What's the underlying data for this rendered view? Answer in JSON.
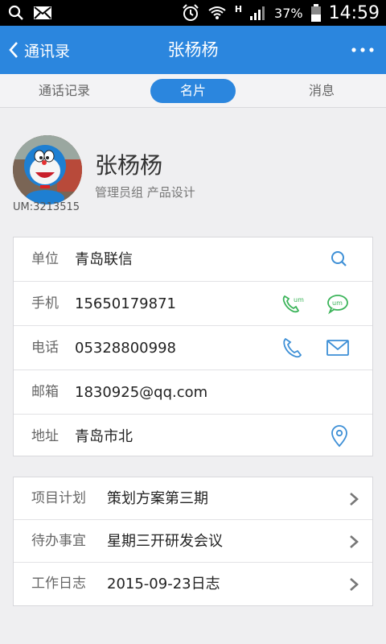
{
  "status_bar": {
    "battery": "37%",
    "network": "H",
    "time": "14:59"
  },
  "header": {
    "back_label": "通讯录",
    "title": "张杨杨"
  },
  "tabs": [
    {
      "label": "通话记录"
    },
    {
      "label": "名片",
      "selected": true
    },
    {
      "label": "消息"
    }
  ],
  "profile": {
    "name": "张杨杨",
    "department": "管理员组 产品设计",
    "um": "UM:3213515"
  },
  "info": [
    {
      "label": "单位",
      "value": "青岛联信",
      "actions": [
        "search-icon"
      ]
    },
    {
      "label": "手机",
      "value": "15650179871",
      "actions": [
        "um-call-icon",
        "um-chat-icon"
      ]
    },
    {
      "label": "电话",
      "value": "05328800998",
      "actions": [
        "phone-icon",
        "mail-icon"
      ]
    },
    {
      "label": "邮箱",
      "value": "1830925@qq.com",
      "actions": []
    },
    {
      "label": "地址",
      "value": "青岛市北",
      "actions": [
        "location-pin-icon"
      ]
    }
  ],
  "links": [
    {
      "label": "项目计划",
      "value": "策划方案第三期"
    },
    {
      "label": "待办事宜",
      "value": "星期三开研发会议"
    },
    {
      "label": "工作日志",
      "value": "2015-09-23日志"
    }
  ],
  "colors": {
    "header_blue": "#2b86de",
    "icon_blue": "#3d8fd6",
    "icon_green": "#3cb45a",
    "background": "#efeff1"
  }
}
